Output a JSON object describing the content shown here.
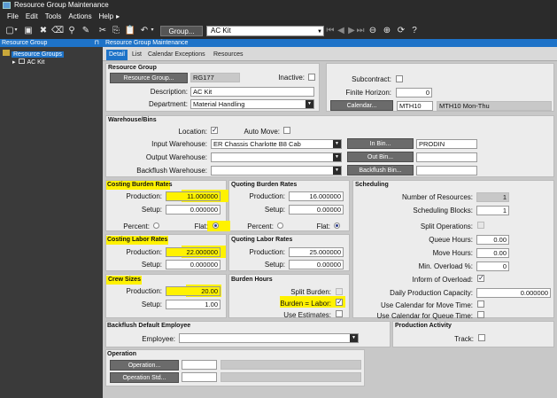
{
  "window": {
    "title": "Resource Group Maintenance"
  },
  "menu": [
    "File",
    "Edit",
    "Tools",
    "Actions",
    "Help"
  ],
  "toolbar": {
    "group_label": "Group...",
    "current_group": "AC Kit"
  },
  "tree": {
    "header": "Resource Group",
    "root": "Resource Groups",
    "child": "AC Kit"
  },
  "main": {
    "header": "Resource Group Maintenance",
    "tabs": [
      "Detail",
      "List",
      "Calendar Exceptions",
      "Resources"
    ]
  },
  "resource_group": {
    "section": "Resource Group",
    "group_button": "Resource Group...",
    "group_id": "RG177",
    "inactive_label": "Inactive:",
    "inactive": false,
    "description_label": "Description:",
    "description": "AC Kit",
    "department_label": "Department:",
    "department": "Material Handling",
    "subcontract_label": "Subcontract:",
    "subcontract": false,
    "finite_horizon_label": "Finite Horizon:",
    "finite_horizon": "0",
    "calendar_button": "Calendar...",
    "calendar_id": "MTH10",
    "calendar_desc": "MTH10 Mon-Thu"
  },
  "warehouse": {
    "section": "Warehouse/Bins",
    "location_label": "Location:",
    "location": true,
    "auto_move_label": "Auto Move:",
    "auto_move": false,
    "input_label": "Input Warehouse:",
    "input_value": "ER Chassis Charlotte B8 Cab",
    "in_bin_button": "In Bin...",
    "in_bin_value": "PRODIN",
    "output_label": "Output Warehouse:",
    "output_value": "",
    "out_bin_button": "Out Bin...",
    "out_bin_value": "",
    "backflush_label": "Backflush Warehouse:",
    "backflush_value": "",
    "backflush_bin_button": "Backflush Bin...",
    "backflush_bin_value": ""
  },
  "costing_burden": {
    "section": "Costing Burden Rates",
    "production_label": "Production:",
    "production": "11.000000",
    "setup_label": "Setup:",
    "setup": "0.000000",
    "percent_label": "Percent:",
    "flat_label": "Flat:",
    "selected": "flat"
  },
  "quoting_burden": {
    "section": "Quoting Burden Rates",
    "production_label": "Production:",
    "production": "16.000000",
    "setup_label": "Setup:",
    "setup": "0.00000",
    "percent_label": "Percent:",
    "flat_label": "Flat:",
    "selected": "flat"
  },
  "costing_labor": {
    "section": "Costing Labor Rates",
    "production_label": "Production:",
    "production": "22.000000",
    "setup_label": "Setup:",
    "setup": "0.000000"
  },
  "quoting_labor": {
    "section": "Quoting Labor Rates",
    "production_label": "Production:",
    "production": "25.000000",
    "setup_label": "Setup:",
    "setup": "0.00000"
  },
  "crew": {
    "section": "Crew Sizes",
    "production_label": "Production:",
    "production": "20.00",
    "setup_label": "Setup:",
    "setup": "1.00"
  },
  "burden_hours": {
    "section": "Burden Hours",
    "split_label": "Split Burden:",
    "split": false,
    "burden_eq_labor_label": "Burden = Labor:",
    "burden_eq_labor": true,
    "use_estimates_label": "Use Estimates:",
    "use_estimates": false
  },
  "scheduling": {
    "section": "Scheduling",
    "num_resources_label": "Number of Resources:",
    "num_resources": "1",
    "blocks_label": "Scheduling Blocks:",
    "blocks": "1",
    "split_ops_label": "Split Operations:",
    "split_ops": false,
    "queue_hours_label": "Queue Hours:",
    "queue_hours": "0.00",
    "move_hours_label": "Move Hours:",
    "move_hours": "0.00",
    "min_overload_label": "Min. Overload %:",
    "min_overload": "0",
    "inform_overload_label": "Inform of Overload:",
    "inform_overload": true,
    "daily_capacity_label": "Daily Production Capacity:",
    "daily_capacity": "0.000000",
    "cal_move_label": "Use Calendar for Move Time:",
    "cal_move": false,
    "cal_queue_label": "Use Calendar for Queue Time:",
    "cal_queue": false
  },
  "backflush_employee": {
    "section": "Backflush Default Employee",
    "employee_label": "Employee:",
    "employee": ""
  },
  "production_activity": {
    "section": "Production Activity",
    "track_label": "Track:",
    "track": false
  },
  "operation": {
    "section": "Operation",
    "operation_button": "Operation...",
    "operation_std_button": "Operation Std..."
  },
  "colors": {
    "accent": "#1e73c8",
    "highlight": "#fff200",
    "chrome": "#2b2b2b",
    "panel": "#ececec"
  }
}
